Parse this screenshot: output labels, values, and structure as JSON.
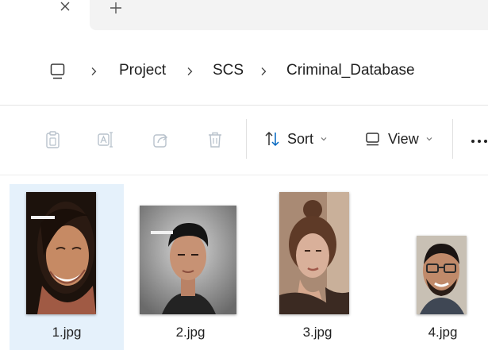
{
  "tabstrip": {
    "close_icon": "close-icon",
    "new_tab_icon": "plus-icon"
  },
  "address": {
    "root_icon": "monitor-icon",
    "breadcrumbs": [
      "Project",
      "SCS",
      "Criminal_Database"
    ]
  },
  "toolbar": {
    "copy_icon": "clipboard-icon",
    "rename_icon": "rename-icon",
    "share_icon": "share-icon",
    "delete_icon": "trash-icon",
    "sort_label": "Sort",
    "view_label": "View",
    "more_icon": "more-icon"
  },
  "files": [
    {
      "name": "1.jpg",
      "selected": true
    },
    {
      "name": "2.jpg",
      "selected": false
    },
    {
      "name": "3.jpg",
      "selected": false
    },
    {
      "name": "4.jpg",
      "selected": false
    }
  ],
  "colors": {
    "selection_bg": "#e5f1fb",
    "tab_area_bg": "#f3f3f3",
    "sort_accent": "#0067c0",
    "disabled_icon": "#b8c2cc"
  }
}
